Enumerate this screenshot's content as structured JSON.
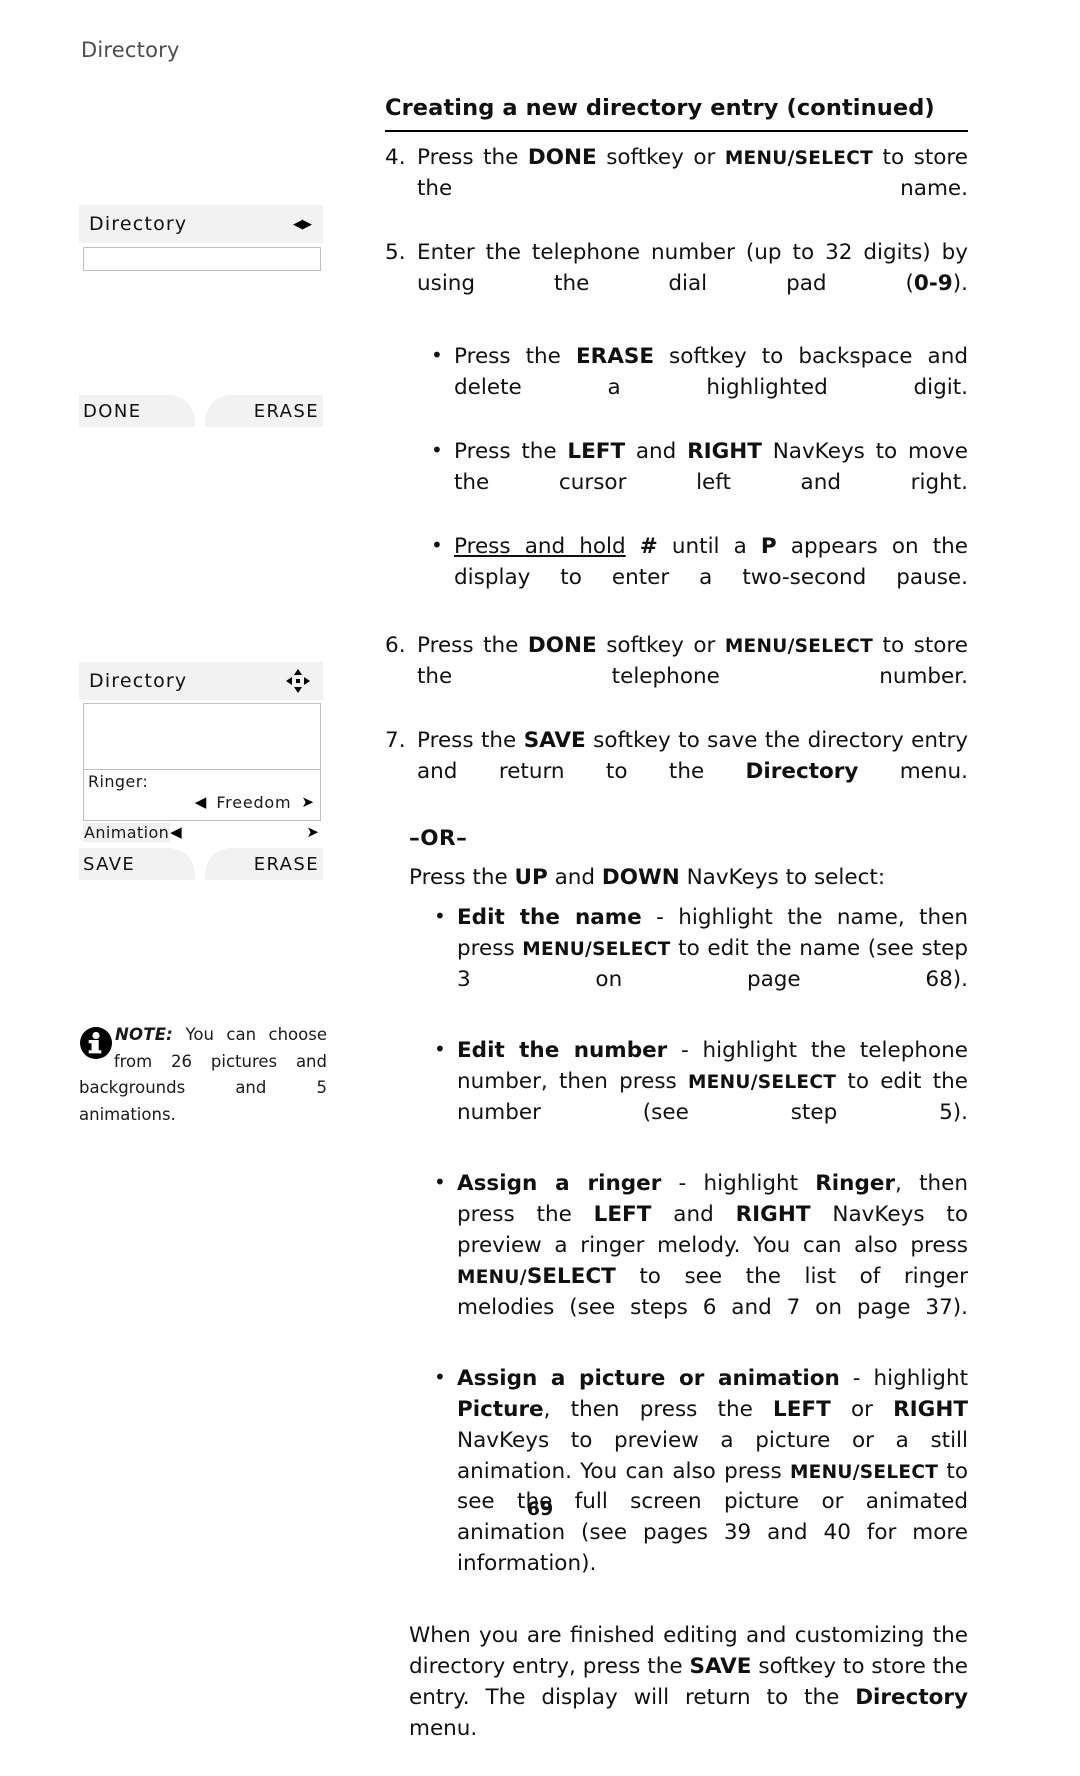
{
  "running_head": "Directory",
  "page_number": "69",
  "section": {
    "title": "Creating a new directory entry (continued)"
  },
  "steps": [
    {
      "number": "4.",
      "parts": [
        {
          "t": "Press the ",
          "s": "n"
        },
        {
          "t": "DONE",
          "s": "b"
        },
        {
          "t": " softkey or ",
          "s": "n"
        },
        {
          "t": "MENU/SELECT",
          "s": "sc"
        },
        {
          "t": " to store the name.",
          "s": "n"
        }
      ]
    },
    {
      "number": "5.",
      "parts": [
        {
          "t": "Enter the telephone number (up to 32 digits) by using the dial pad (",
          "s": "n"
        },
        {
          "t": "0-9",
          "s": "b"
        },
        {
          "t": ").",
          "s": "n"
        }
      ]
    },
    {
      "number": "6.",
      "parts": [
        {
          "t": "Press the ",
          "s": "n"
        },
        {
          "t": "DONE",
          "s": "b"
        },
        {
          "t": " softkey or ",
          "s": "n"
        },
        {
          "t": "MENU/SELECT",
          "s": "sc"
        },
        {
          "t": " to store the telephone number.",
          "s": "n"
        }
      ]
    },
    {
      "number": "7.",
      "parts": [
        {
          "t": "Press the ",
          "s": "n"
        },
        {
          "t": "SAVE",
          "s": "b"
        },
        {
          "t": " softkey to save the directory entry and return to the ",
          "s": "n"
        },
        {
          "t": "Directory",
          "s": "b"
        },
        {
          "t": " menu.",
          "s": "n"
        }
      ]
    }
  ],
  "step5_bullets": [
    {
      "parts": [
        {
          "t": "Press the ",
          "s": "n"
        },
        {
          "t": "ERASE",
          "s": "b"
        },
        {
          "t": " softkey to backspace and delete a highlighted digit.",
          "s": "n"
        }
      ]
    },
    {
      "parts": [
        {
          "t": "Press the ",
          "s": "n"
        },
        {
          "t": "LEFT",
          "s": "b"
        },
        {
          "t": " and ",
          "s": "n"
        },
        {
          "t": "RIGHT",
          "s": "b"
        },
        {
          "t": " NavKeys to move the cursor left and right.",
          "s": "n"
        }
      ]
    },
    {
      "parts": [
        {
          "t": "Press and hold",
          "s": "u"
        },
        {
          "t": " ",
          "s": "n"
        },
        {
          "t": "#",
          "s": "b"
        },
        {
          "t": " until a ",
          "s": "n"
        },
        {
          "t": "P",
          "s": "b"
        },
        {
          "t": " appears on the display to enter a two-second pause.",
          "s": "n"
        }
      ]
    }
  ],
  "or_label": "–OR–",
  "or_intro": [
    {
      "t": "Press the ",
      "s": "n"
    },
    {
      "t": "UP",
      "s": "b"
    },
    {
      "t": " and ",
      "s": "n"
    },
    {
      "t": "DOWN",
      "s": "b"
    },
    {
      "t": " NavKeys to select:",
      "s": "n"
    }
  ],
  "option_bullets": [
    {
      "parts": [
        {
          "t": "Edit the name",
          "s": "b"
        },
        {
          "t": " - highlight the name, then press ",
          "s": "n"
        },
        {
          "t": "MENU/SELECT",
          "s": "sc"
        },
        {
          "t": " to edit the name (see step 3 on page 68).",
          "s": "n"
        }
      ]
    },
    {
      "parts": [
        {
          "t": "Edit the number",
          "s": "b"
        },
        {
          "t": " - highlight the telephone number, then press ",
          "s": "n"
        },
        {
          "t": "MENU/SELECT",
          "s": "sc"
        },
        {
          "t": " to edit the number (see step 5).",
          "s": "n"
        }
      ]
    },
    {
      "parts": [
        {
          "t": "Assign a ringer",
          "s": "b"
        },
        {
          "t": " - highlight ",
          "s": "n"
        },
        {
          "t": "Ringer",
          "s": "b"
        },
        {
          "t": ", then press the ",
          "s": "n"
        },
        {
          "t": "LEFT",
          "s": "b"
        },
        {
          "t": " and ",
          "s": "n"
        },
        {
          "t": "RIGHT",
          "s": "b"
        },
        {
          "t": " NavKeys to preview a ringer melody. You can also press ",
          "s": "n"
        },
        {
          "t": "MENU/",
          "s": "sc"
        },
        {
          "t": "SELECT",
          "s": "b"
        },
        {
          "t": " to see the list of ringer melodies (see steps 6 and 7 on page 37).",
          "s": "n"
        }
      ]
    },
    {
      "parts": [
        {
          "t": "Assign a picture or animation",
          "s": "b"
        },
        {
          "t": " - highlight ",
          "s": "n"
        },
        {
          "t": "Picture",
          "s": "b"
        },
        {
          "t": ", then press the ",
          "s": "n"
        },
        {
          "t": "LEFT",
          "s": "b"
        },
        {
          "t": " or ",
          "s": "n"
        },
        {
          "t": "RIGHT",
          "s": "b"
        },
        {
          "t": " NavKeys to preview a picture or a still animation. You can also press ",
          "s": "n"
        },
        {
          "t": "MENU/SELECT",
          "s": "sc"
        },
        {
          "t": " to see the full screen picture or animated animation (see pages 39 and 40 for more information).",
          "s": "n"
        }
      ]
    }
  ],
  "closing_paragraph": [
    {
      "t": "When you are finished editing and customizing the directory entry, press the ",
      "s": "n"
    },
    {
      "t": "SAVE",
      "s": "b"
    },
    {
      "t": " softkey to store the entry. The display will return to the ",
      "s": "n"
    },
    {
      "t": "Directory",
      "s": "b"
    },
    {
      "t": " menu.",
      "s": "n"
    }
  ],
  "lcd_one": {
    "title": "Directory",
    "nav_icon": "left-right-arrows-icon",
    "field_value": "",
    "softkey_left": "DONE",
    "softkey_right": "ERASE"
  },
  "lcd_two": {
    "title": "Directory",
    "nav_icon": "four-way-navigation-icon",
    "ringer_label": "Ringer:",
    "ringer_value": "Freedom",
    "animation_label": "Animation",
    "softkey_left": "SAVE",
    "softkey_right": "ERASE"
  },
  "note": {
    "icon": "info-icon",
    "label": "NOTE:",
    "text": " You can choose from 26 pictures and backgrounds and 5 animations."
  }
}
